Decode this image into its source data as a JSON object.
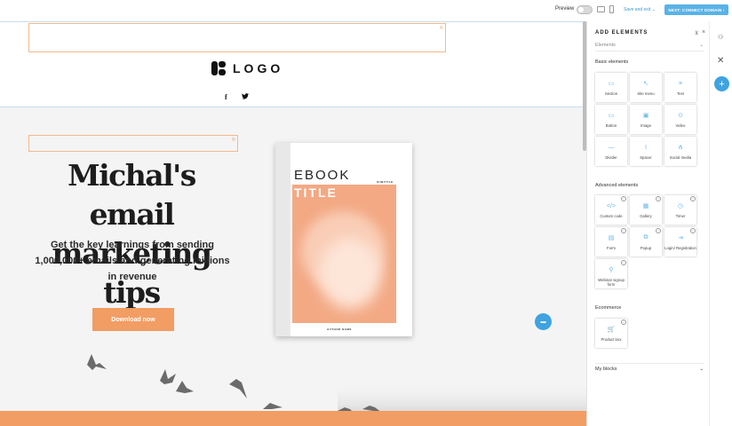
{
  "topbar": {
    "preview_label": "Preview",
    "save_label": "Save and exit",
    "next_label": "NEXT: CONNECT DOMAIN"
  },
  "header": {
    "logo_text": "LOGO",
    "social": [
      "f",
      "🐦"
    ]
  },
  "hero": {
    "headline": "Michal's email marketing tips",
    "subtext": "Get the key learnings from sending 1,000,000+ emails and generating millions in revenue",
    "cta_label": "Download now",
    "book": {
      "title_top": "EBOOK",
      "title_main": "TITLE",
      "subtitle": "SUBTITLE",
      "author": "AUTHOR NAME"
    }
  },
  "panel": {
    "title": "ADD ELEMENTS",
    "dropdown": "Elements",
    "basic_heading": "Basic elements",
    "basic": [
      {
        "label": "Section",
        "icon": "section-icon"
      },
      {
        "label": "Site menu",
        "icon": "site-menu-icon"
      },
      {
        "label": "Text",
        "icon": "text-icon"
      },
      {
        "label": "Button",
        "icon": "button-icon"
      },
      {
        "label": "Image",
        "icon": "image-icon"
      },
      {
        "label": "Video",
        "icon": "video-icon"
      },
      {
        "label": "Divider",
        "icon": "divider-icon"
      },
      {
        "label": "Spacer",
        "icon": "spacer-icon"
      },
      {
        "label": "Social media",
        "icon": "social-media-icon"
      }
    ],
    "advanced_heading": "Advanced elements",
    "advanced": [
      {
        "label": "Custom code",
        "icon": "code-icon"
      },
      {
        "label": "Gallery",
        "icon": "gallery-icon"
      },
      {
        "label": "Timer",
        "icon": "timer-icon"
      },
      {
        "label": "Form",
        "icon": "form-icon"
      },
      {
        "label": "Popup",
        "icon": "popup-icon"
      },
      {
        "label": "Login/ Registration",
        "icon": "login-icon"
      },
      {
        "label": "Webinar signup form",
        "icon": "webinar-icon"
      }
    ],
    "ecommerce_heading": "Ecommerce",
    "ecommerce": [
      {
        "label": "Product box",
        "icon": "cart-icon"
      }
    ],
    "my_blocks": "My blocks"
  },
  "colors": {
    "accent": "#f29d63",
    "primary_blue": "#3fa3e0"
  }
}
